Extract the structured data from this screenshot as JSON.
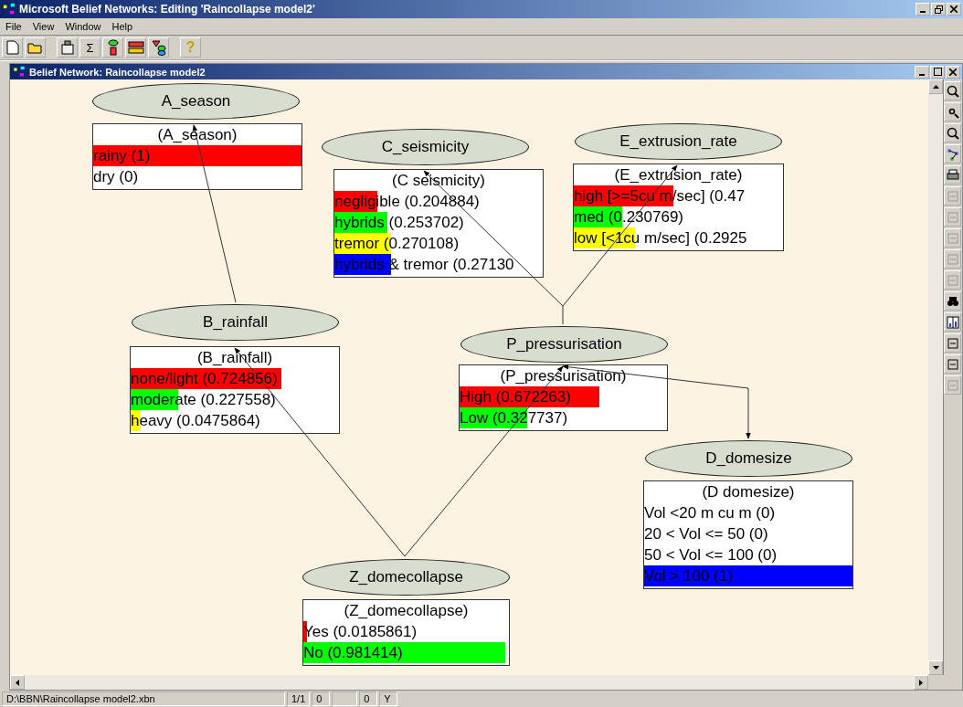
{
  "window": {
    "title": "Microsoft Belief Networks: Editing 'Raincollapse model2'"
  },
  "menu": [
    "File",
    "View",
    "Window",
    "Help"
  ],
  "toolbar": {
    "sum_glyph": "Σ",
    "help_glyph": "?"
  },
  "document": {
    "title": "Belief Network:  Raincollapse model2"
  },
  "nodes": [
    {
      "name": "A_season",
      "title": "(A_season)",
      "states": [
        {
          "label": "rainy (1)",
          "level": 1,
          "color": "#ff0000"
        },
        {
          "label": "dry (0)"
        }
      ]
    },
    {
      "name": "C_seismicity",
      "title": "(C seismicity)",
      "states": [
        {
          "label": "negligible (0.204884)",
          "level": 0.205,
          "color": "#ff0000"
        },
        {
          "label": "hybrids (0.253702)",
          "level": 0.254,
          "color": "#00ff00"
        },
        {
          "label": "tremor (0.270108)",
          "level": 0.27,
          "color": "#ffff00"
        },
        {
          "label": "hybrids & tremor (0.27130",
          "level": 0.271,
          "color": "#0000ff"
        }
      ]
    },
    {
      "name": "E_extrusion_rate",
      "title": "(E_extrusion_rate)",
      "states": [
        {
          "label": "high [>=5cu m/sec] (0.47",
          "level": 0.476,
          "color": "#ff0000"
        },
        {
          "label": "med (0.230769)",
          "level": 0.231,
          "color": "#00ff00"
        },
        {
          "label": "low [<1cu m/sec] (0.2925",
          "level": 0.2925,
          "color": "#ffff00"
        }
      ]
    },
    {
      "name": "B_rainfall",
      "title": "(B_rainfall)",
      "states": [
        {
          "label": "none/light (0.724856)",
          "level": 0.725,
          "color": "#ff0000"
        },
        {
          "label": "moderate (0.227558)",
          "level": 0.228,
          "color": "#00ff00"
        },
        {
          "label": "heavy (0.0475864)",
          "level": 0.048,
          "color": "#ffff00"
        }
      ]
    },
    {
      "name": "P_pressurisation",
      "title": "(P_pressurisation)",
      "states": [
        {
          "label": "High (0.672263)",
          "level": 0.672,
          "color": "#ff0000"
        },
        {
          "label": "Low (0.327737)",
          "level": 0.328,
          "color": "#00ff00"
        }
      ]
    },
    {
      "name": "D_domesize",
      "title": "(D domesize)",
      "states": [
        {
          "label": "Vol <20 m cu m (0)"
        },
        {
          "label": "20 < Vol <= 50 (0)"
        },
        {
          "label": "50 < Vol <= 100 (0)"
        },
        {
          "label": "Vol > 100 (1)",
          "level": 1,
          "color": "#0000ff"
        }
      ]
    },
    {
      "name": "Z_domecollapse",
      "title": "(Z_domecollapse)",
      "states": [
        {
          "label": "Yes (0.0185861)",
          "level": 0.019,
          "color": "#ff0000"
        },
        {
          "label": "No (0.981414)",
          "level": 0.981,
          "color": "#00ff00"
        }
      ]
    }
  ],
  "status_bar": [
    "D:\\BBN\\Raincollapse model2.xbn",
    "1/1",
    "0",
    "0",
    "Y"
  ]
}
